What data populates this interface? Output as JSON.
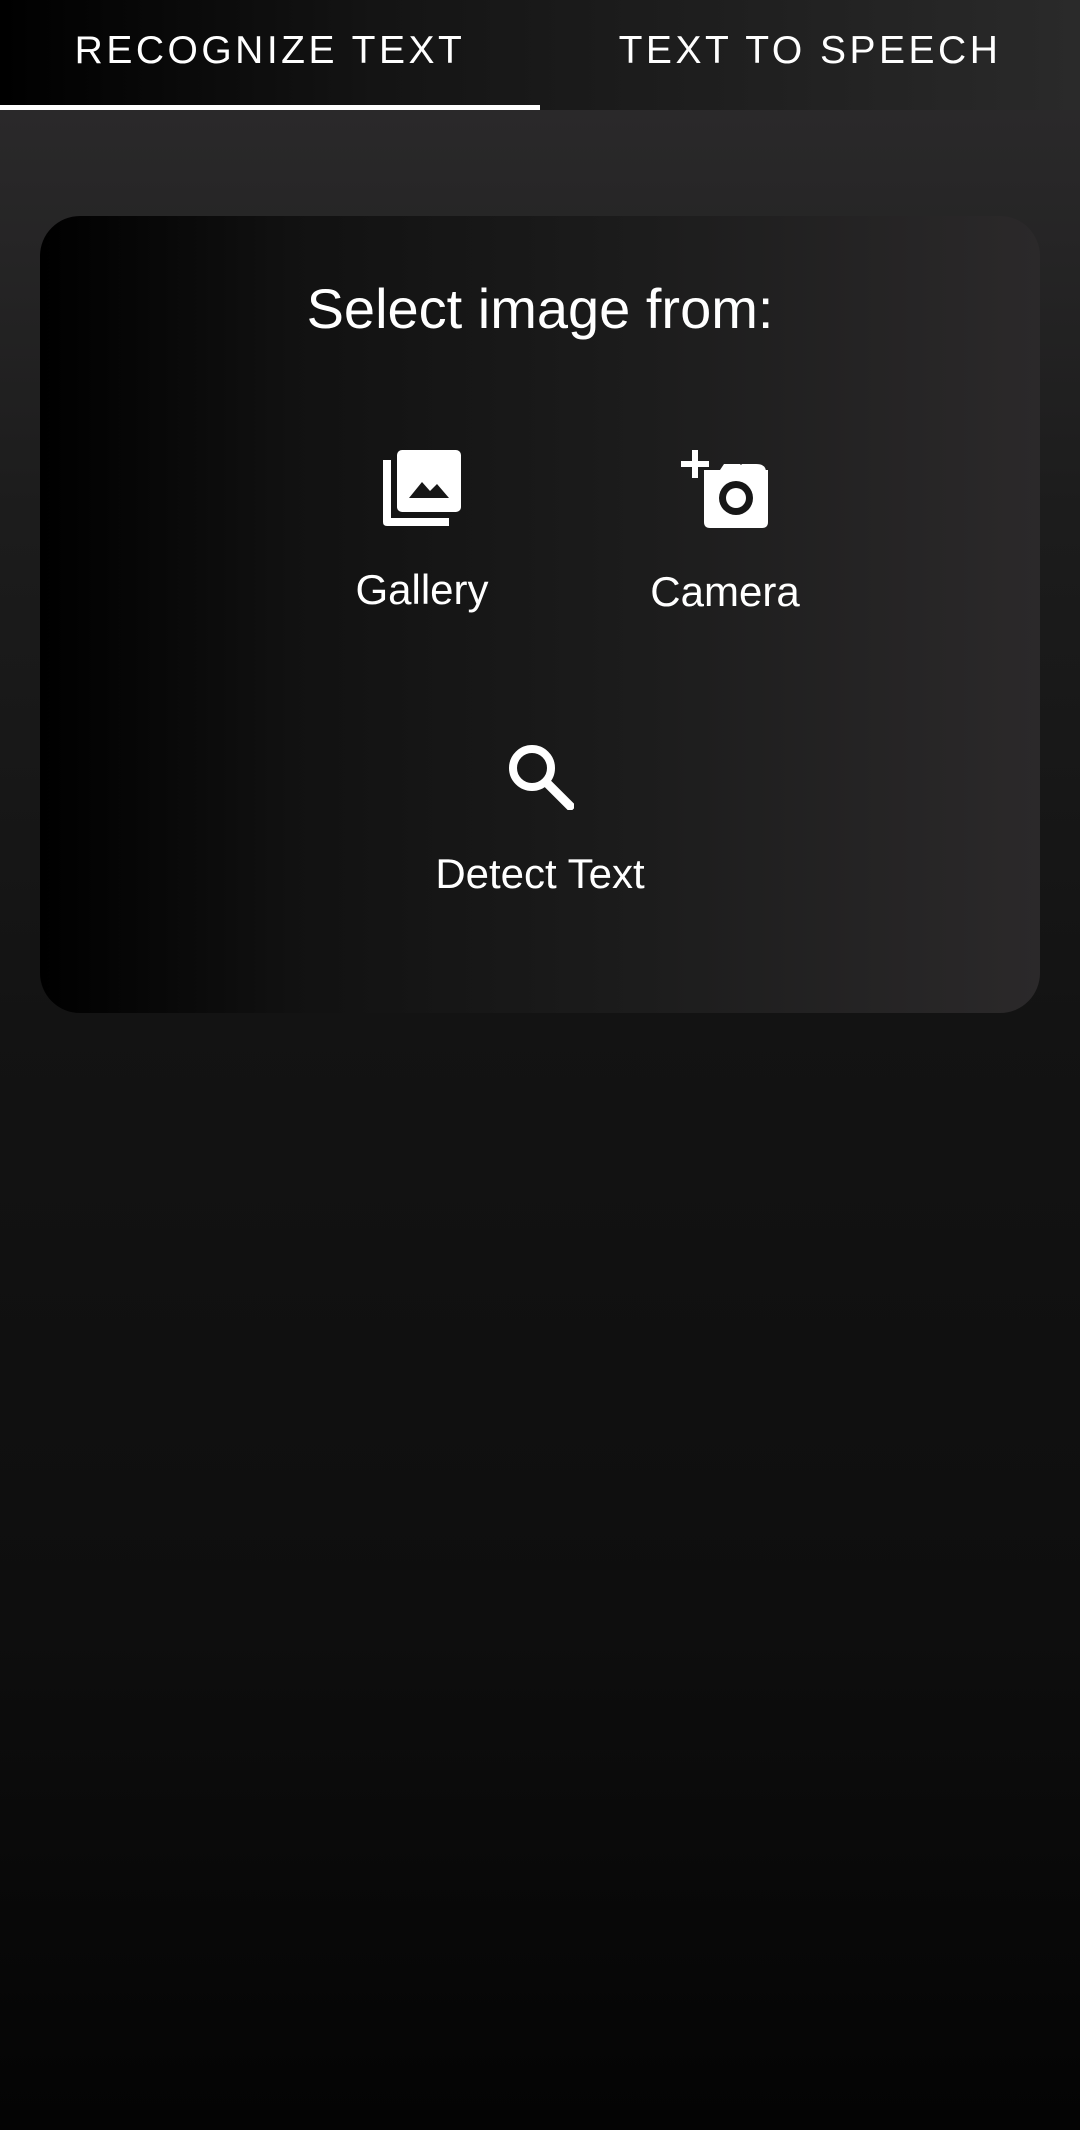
{
  "tabs": [
    {
      "label": "RECOGNIZE TEXT",
      "selected": true
    },
    {
      "label": "TEXT TO SPEECH",
      "selected": false
    }
  ],
  "card": {
    "title": "Select image from:",
    "options": {
      "gallery": {
        "label": "Gallery",
        "icon": "photo-library-icon"
      },
      "camera": {
        "label": "Camera",
        "icon": "add-a-photo-icon"
      },
      "detect": {
        "label": "Detect Text",
        "icon": "search-icon"
      }
    }
  },
  "colors": {
    "text": "#ffffff",
    "tab_indicator": "#ffffff",
    "background": "#141414"
  }
}
